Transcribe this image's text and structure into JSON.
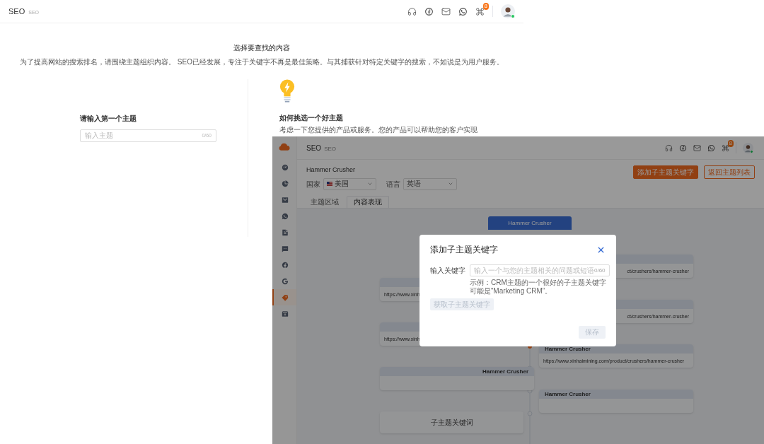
{
  "header": {
    "title": "SEO",
    "subtitle": "SEO",
    "badge": "8",
    "online": true
  },
  "intro": {
    "title": "选择要查找的内容",
    "description": "为了提高网站的搜索排名，请围绕主题组织内容。 SEO已经发展，专注于关键字不再是最佳策略。与其捕获针对特定关键字的搜索，不如说是为用户服务。"
  },
  "topic_input": {
    "label": "请输入第一个主题",
    "placeholder": "输入主题",
    "counter": "0/60"
  },
  "tips": {
    "title": "如何挑选一个好主题",
    "description": "考虑一下您提供的产品或服务。您的产品可以帮助您的客户实现"
  },
  "inset": {
    "header": {
      "title": "SEO",
      "subtitle": "SEO",
      "badge": "8",
      "online": true
    },
    "sidebar_items": [
      {
        "selected": false
      },
      {
        "selected": false
      },
      {
        "selected": false
      },
      {
        "selected": false
      },
      {
        "selected": false
      },
      {
        "selected": false
      },
      {
        "selected": false
      },
      {
        "selected": false
      },
      {
        "selected": true
      },
      {
        "selected": false
      }
    ],
    "topic": {
      "title": "Hammer Crusher",
      "country_label": "国家",
      "country": "美国",
      "language_label": "语言",
      "language": "英语"
    },
    "actions": [
      {
        "label": "添加子主题关键字",
        "kind": "primary"
      },
      {
        "label": "返回主题列表",
        "kind": "outline"
      }
    ],
    "tabs": [
      {
        "label": "主题区域",
        "selected": false
      },
      {
        "label": "内容表现",
        "selected": true
      }
    ],
    "map": {
      "root": "Hammer Crusher",
      "nodes": [
        {
          "kind": "card",
          "url": "https://www.xinh"
        },
        {
          "kind": "card",
          "url": "https://www.xinh"
        },
        {
          "kind": "card",
          "title": "Hammer Crusher"
        },
        {
          "kind": "plain",
          "label": "子主题关键词"
        },
        {
          "kind": "card",
          "url": "ct/crushers/hammer-crusher"
        },
        {
          "kind": "card",
          "url": "ct/crushers/hammer-crusher"
        },
        {
          "kind": "card",
          "title": "Hammer Crusher",
          "url": "https://www.xinhaimining.com/product/crushers/hammer-crusher"
        },
        {
          "kind": "card",
          "title": "Hammer Crusher"
        }
      ]
    },
    "dialog": {
      "title": "添加子主题关键字",
      "field_label": "输入关键字",
      "placeholder": "输入一个与您的主题相关的问题或短语",
      "counter": "0/60",
      "hint": "示例：CRM主题的一个很好的子主题关键字可能是“Marketing CRM”。",
      "fetch_button": {
        "label": "获取子主题关键字",
        "disabled": true
      },
      "save_button": {
        "label": "保存",
        "disabled": true
      }
    }
  }
}
